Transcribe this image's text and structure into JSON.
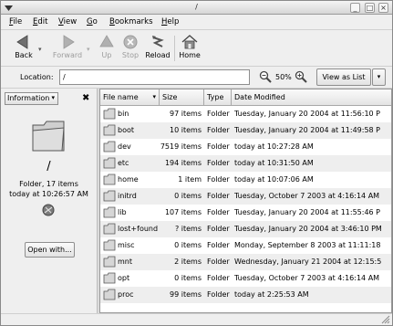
{
  "window": {
    "title": "/"
  },
  "menubar": [
    {
      "label": "File",
      "u": "F",
      "rest": "ile"
    },
    {
      "label": "Edit",
      "u": "E",
      "rest": "dit"
    },
    {
      "label": "View",
      "u": "V",
      "rest": "iew"
    },
    {
      "label": "Go",
      "u": "G",
      "rest": "o"
    },
    {
      "label": "Bookmarks",
      "u": "B",
      "rest": "ookmarks"
    },
    {
      "label": "Help",
      "u": "H",
      "rest": "elp"
    }
  ],
  "toolbar": {
    "back": "Back",
    "forward": "Forward",
    "up": "Up",
    "stop": "Stop",
    "reload": "Reload",
    "home": "Home"
  },
  "location": {
    "label": "Location:",
    "value": "/",
    "zoom": "50%",
    "view_button": "View as List"
  },
  "sidepane": {
    "selector": "Information",
    "folder_name": "/",
    "info_line1": "Folder, 17 items",
    "info_line2": "today at 10:26:57 AM",
    "open_with": "Open with..."
  },
  "columns": {
    "name": "File name",
    "size": "Size",
    "type": "Type",
    "date": "Date Modified"
  },
  "files": [
    {
      "name": "bin",
      "size": "97 items",
      "type": "Folder",
      "date": "Tuesday, January 20 2004 at 11:56:10 P"
    },
    {
      "name": "boot",
      "size": "10 items",
      "type": "Folder",
      "date": "Tuesday, January 20 2004 at 11:49:58 P"
    },
    {
      "name": "dev",
      "size": "7519 items",
      "type": "Folder",
      "date": "today at 10:27:28 AM"
    },
    {
      "name": "etc",
      "size": "194 items",
      "type": "Folder",
      "date": "today at 10:31:50 AM"
    },
    {
      "name": "home",
      "size": "1 item",
      "type": "Folder",
      "date": "today at 10:07:06 AM"
    },
    {
      "name": "initrd",
      "size": "0 items",
      "type": "Folder",
      "date": "Tuesday, October 7 2003 at 4:16:14 AM"
    },
    {
      "name": "lib",
      "size": "107 items",
      "type": "Folder",
      "date": "Tuesday, January 20 2004 at 11:55:46 P"
    },
    {
      "name": "lost+found",
      "size": "? items",
      "type": "Folder",
      "date": "Tuesday, January 20 2004 at 3:46:10 PM"
    },
    {
      "name": "misc",
      "size": "0 items",
      "type": "Folder",
      "date": "Monday, September 8 2003 at 11:11:18"
    },
    {
      "name": "mnt",
      "size": "2 items",
      "type": "Folder",
      "date": "Wednesday, January 21 2004 at 12:15:5"
    },
    {
      "name": "opt",
      "size": "0 items",
      "type": "Folder",
      "date": "Tuesday, October 7 2003 at 4:16:14 AM"
    },
    {
      "name": "proc",
      "size": "99 items",
      "type": "Folder",
      "date": "today at 2:25:53 AM"
    }
  ]
}
